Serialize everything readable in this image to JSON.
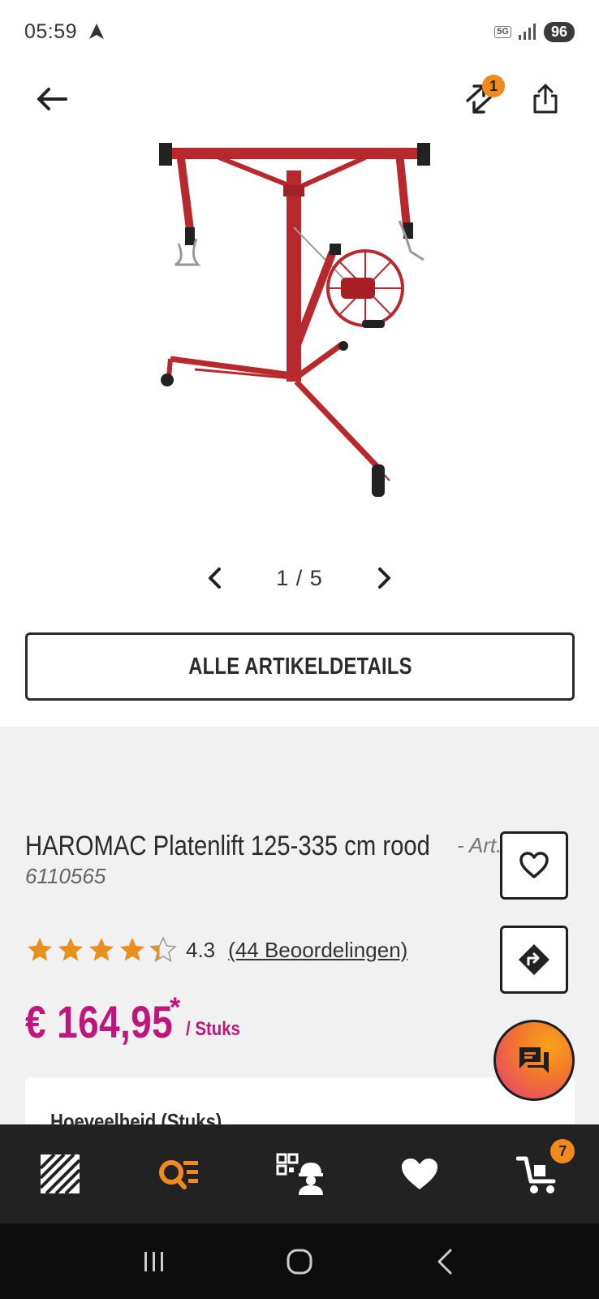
{
  "status_bar": {
    "time": "05:59",
    "network": "5G",
    "battery": "96"
  },
  "top_bar": {
    "compare_count": "1"
  },
  "gallery": {
    "pager": "1 / 5"
  },
  "details_button": {
    "label": "ALLE ARTIKELDETAILS"
  },
  "product": {
    "title": "HAROMAC Platenlift 125-335 cm rood",
    "art_prefix": "- Art.nr.",
    "art_number": "6110565",
    "rating": 4.3,
    "rating_label": "4.3",
    "reviews_label": "(44 Beoordelingen)",
    "price": "€ 164,95",
    "price_asterisk": "*",
    "price_unit": "/ Stuks",
    "quantity_label": "Hoeveelheid (Stuks)"
  },
  "bottom_nav": {
    "cart_count": "7"
  },
  "colors": {
    "accent": "#f08a1c",
    "price": "#c0157a",
    "nav_bg": "#222222",
    "section_bg": "#f1f1f1"
  },
  "icons": [
    "navigation-arrow-icon",
    "back-arrow-icon",
    "compare-icon",
    "share-icon",
    "heart-icon",
    "route-icon",
    "chat-icon",
    "home-logo-icon",
    "search-list-icon",
    "qr-worker-icon",
    "heart-icon",
    "cart-icon"
  ]
}
